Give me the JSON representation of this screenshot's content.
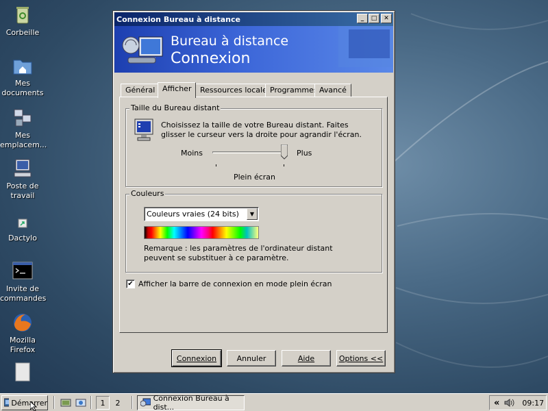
{
  "desktop": {
    "icons": [
      {
        "label": "Corbeille",
        "icon": "recycle-bin-icon"
      },
      {
        "label": "Mes documents",
        "icon": "my-documents-icon"
      },
      {
        "label": "Mes emplacem...",
        "icon": "network-places-icon"
      },
      {
        "label": "Poste de travail",
        "icon": "my-computer-icon"
      },
      {
        "label": "Dactylo",
        "icon": "shortcut-icon"
      },
      {
        "label": "Invite de commandes",
        "icon": "command-prompt-icon"
      },
      {
        "label": "Mozilla Firefox",
        "icon": "firefox-icon"
      }
    ]
  },
  "window": {
    "title": "Connexion Bureau à distance",
    "banner_line1": "Bureau à distance",
    "banner_line2": "Connexion",
    "tabs": [
      "Général",
      "Afficher",
      "Ressources locales",
      "Programmes",
      "Avancé"
    ],
    "active_tab": "Afficher",
    "size_group": {
      "label": "Taille du Bureau distant",
      "description": "Choisissez la taille de votre Bureau distant. Faites glisser le curseur vers la droite pour agrandir l'écran.",
      "slider_min_label": "Moins",
      "slider_max_label": "Plus",
      "slider_value_fraction": 1.0,
      "slider_value_label": "Plein écran"
    },
    "colors_group": {
      "label": "Couleurs",
      "selected_option": "Couleurs vraies (24 bits)",
      "note": "Remarque : les paramètres de l'ordinateur distant peuvent se substituer à ce paramètre."
    },
    "fullscreen_bar_checkbox": {
      "label": "Afficher la barre de connexion en mode plein écran",
      "checked": true
    },
    "buttons": {
      "connect": "Connexion",
      "cancel": "Annuler",
      "help": "Aide",
      "options": "Options <<"
    }
  },
  "taskbar": {
    "start_label": "Démarrer",
    "workspaces": [
      "1",
      "2"
    ],
    "task_label": "Connexion Bureau à dist...",
    "clock": "09:17",
    "tray_chevron": "«"
  }
}
